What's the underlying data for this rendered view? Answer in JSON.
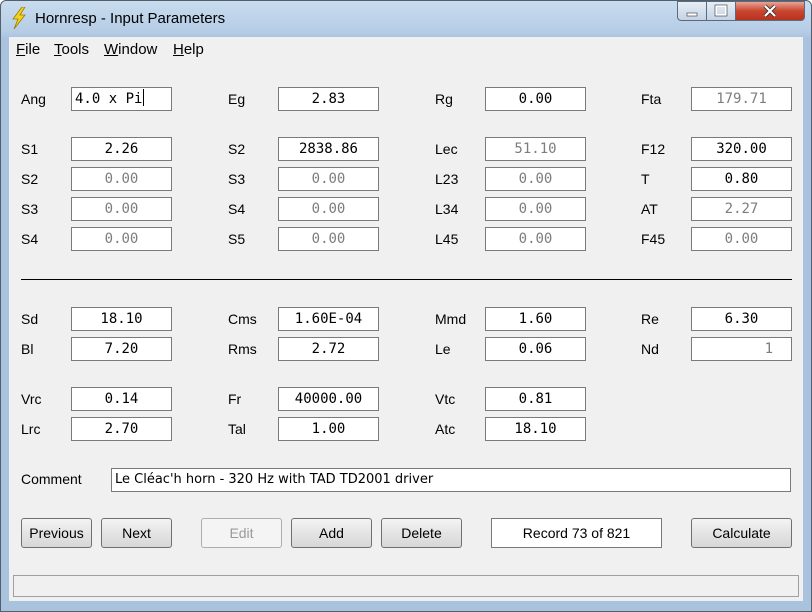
{
  "window": {
    "title": "Hornresp - Input Parameters"
  },
  "menu": [
    "File",
    "Tools",
    "Window",
    "Help"
  ],
  "params": {
    "Ang": {
      "label": "Ang",
      "value": "4.0 x Pi"
    },
    "Eg": {
      "label": "Eg",
      "value": "2.83"
    },
    "Rg": {
      "label": "Rg",
      "value": "0.00"
    },
    "Fta": {
      "label": "Fta",
      "value": "179.71"
    },
    "S1": {
      "label": "S1",
      "value": "2.26"
    },
    "S2a": {
      "label": "S2",
      "value": "2838.86"
    },
    "Lec": {
      "label": "Lec",
      "value": "51.10"
    },
    "F12": {
      "label": "F12",
      "value": "320.00"
    },
    "S2": {
      "label": "S2",
      "value": "0.00"
    },
    "S3a": {
      "label": "S3",
      "value": "0.00"
    },
    "L23": {
      "label": "L23",
      "value": "0.00"
    },
    "T": {
      "label": "T",
      "value": "0.80"
    },
    "S3": {
      "label": "S3",
      "value": "0.00"
    },
    "S4a": {
      "label": "S4",
      "value": "0.00"
    },
    "L34": {
      "label": "L34",
      "value": "0.00"
    },
    "AT": {
      "label": "AT",
      "value": "2.27"
    },
    "S4": {
      "label": "S4",
      "value": "0.00"
    },
    "S5": {
      "label": "S5",
      "value": "0.00"
    },
    "L45": {
      "label": "L45",
      "value": "0.00"
    },
    "F45": {
      "label": "F45",
      "value": "0.00"
    },
    "Sd": {
      "label": "Sd",
      "value": "18.10"
    },
    "Cms": {
      "label": "Cms",
      "value": "1.60E-04"
    },
    "Mmd": {
      "label": "Mmd",
      "value": "1.60"
    },
    "Re": {
      "label": "Re",
      "value": "6.30"
    },
    "Bl": {
      "label": "Bl",
      "value": "7.20"
    },
    "Rms": {
      "label": "Rms",
      "value": "2.72"
    },
    "Le": {
      "label": "Le",
      "value": "0.06"
    },
    "Nd": {
      "label": "Nd",
      "value": "1"
    },
    "Vrc": {
      "label": "Vrc",
      "value": "0.14"
    },
    "Fr": {
      "label": "Fr",
      "value": "40000.00"
    },
    "Vtc": {
      "label": "Vtc",
      "value": "0.81"
    },
    "Lrc": {
      "label": "Lrc",
      "value": "2.70"
    },
    "Tal": {
      "label": "Tal",
      "value": "1.00"
    },
    "Atc": {
      "label": "Atc",
      "value": "18.10"
    }
  },
  "comment": {
    "label": "Comment",
    "value": "Le Cléac'h horn - 320 Hz with TAD TD2001 driver"
  },
  "buttons": {
    "previous": "Previous",
    "next": "Next",
    "edit": "Edit",
    "add": "Add",
    "delete": "Delete",
    "calculate": "Calculate"
  },
  "record": "Record 73 of 821",
  "colors": {
    "accent_title": "#b6cde6",
    "close_button": "#c9452f",
    "disabled_text": "#7d7d7d"
  }
}
